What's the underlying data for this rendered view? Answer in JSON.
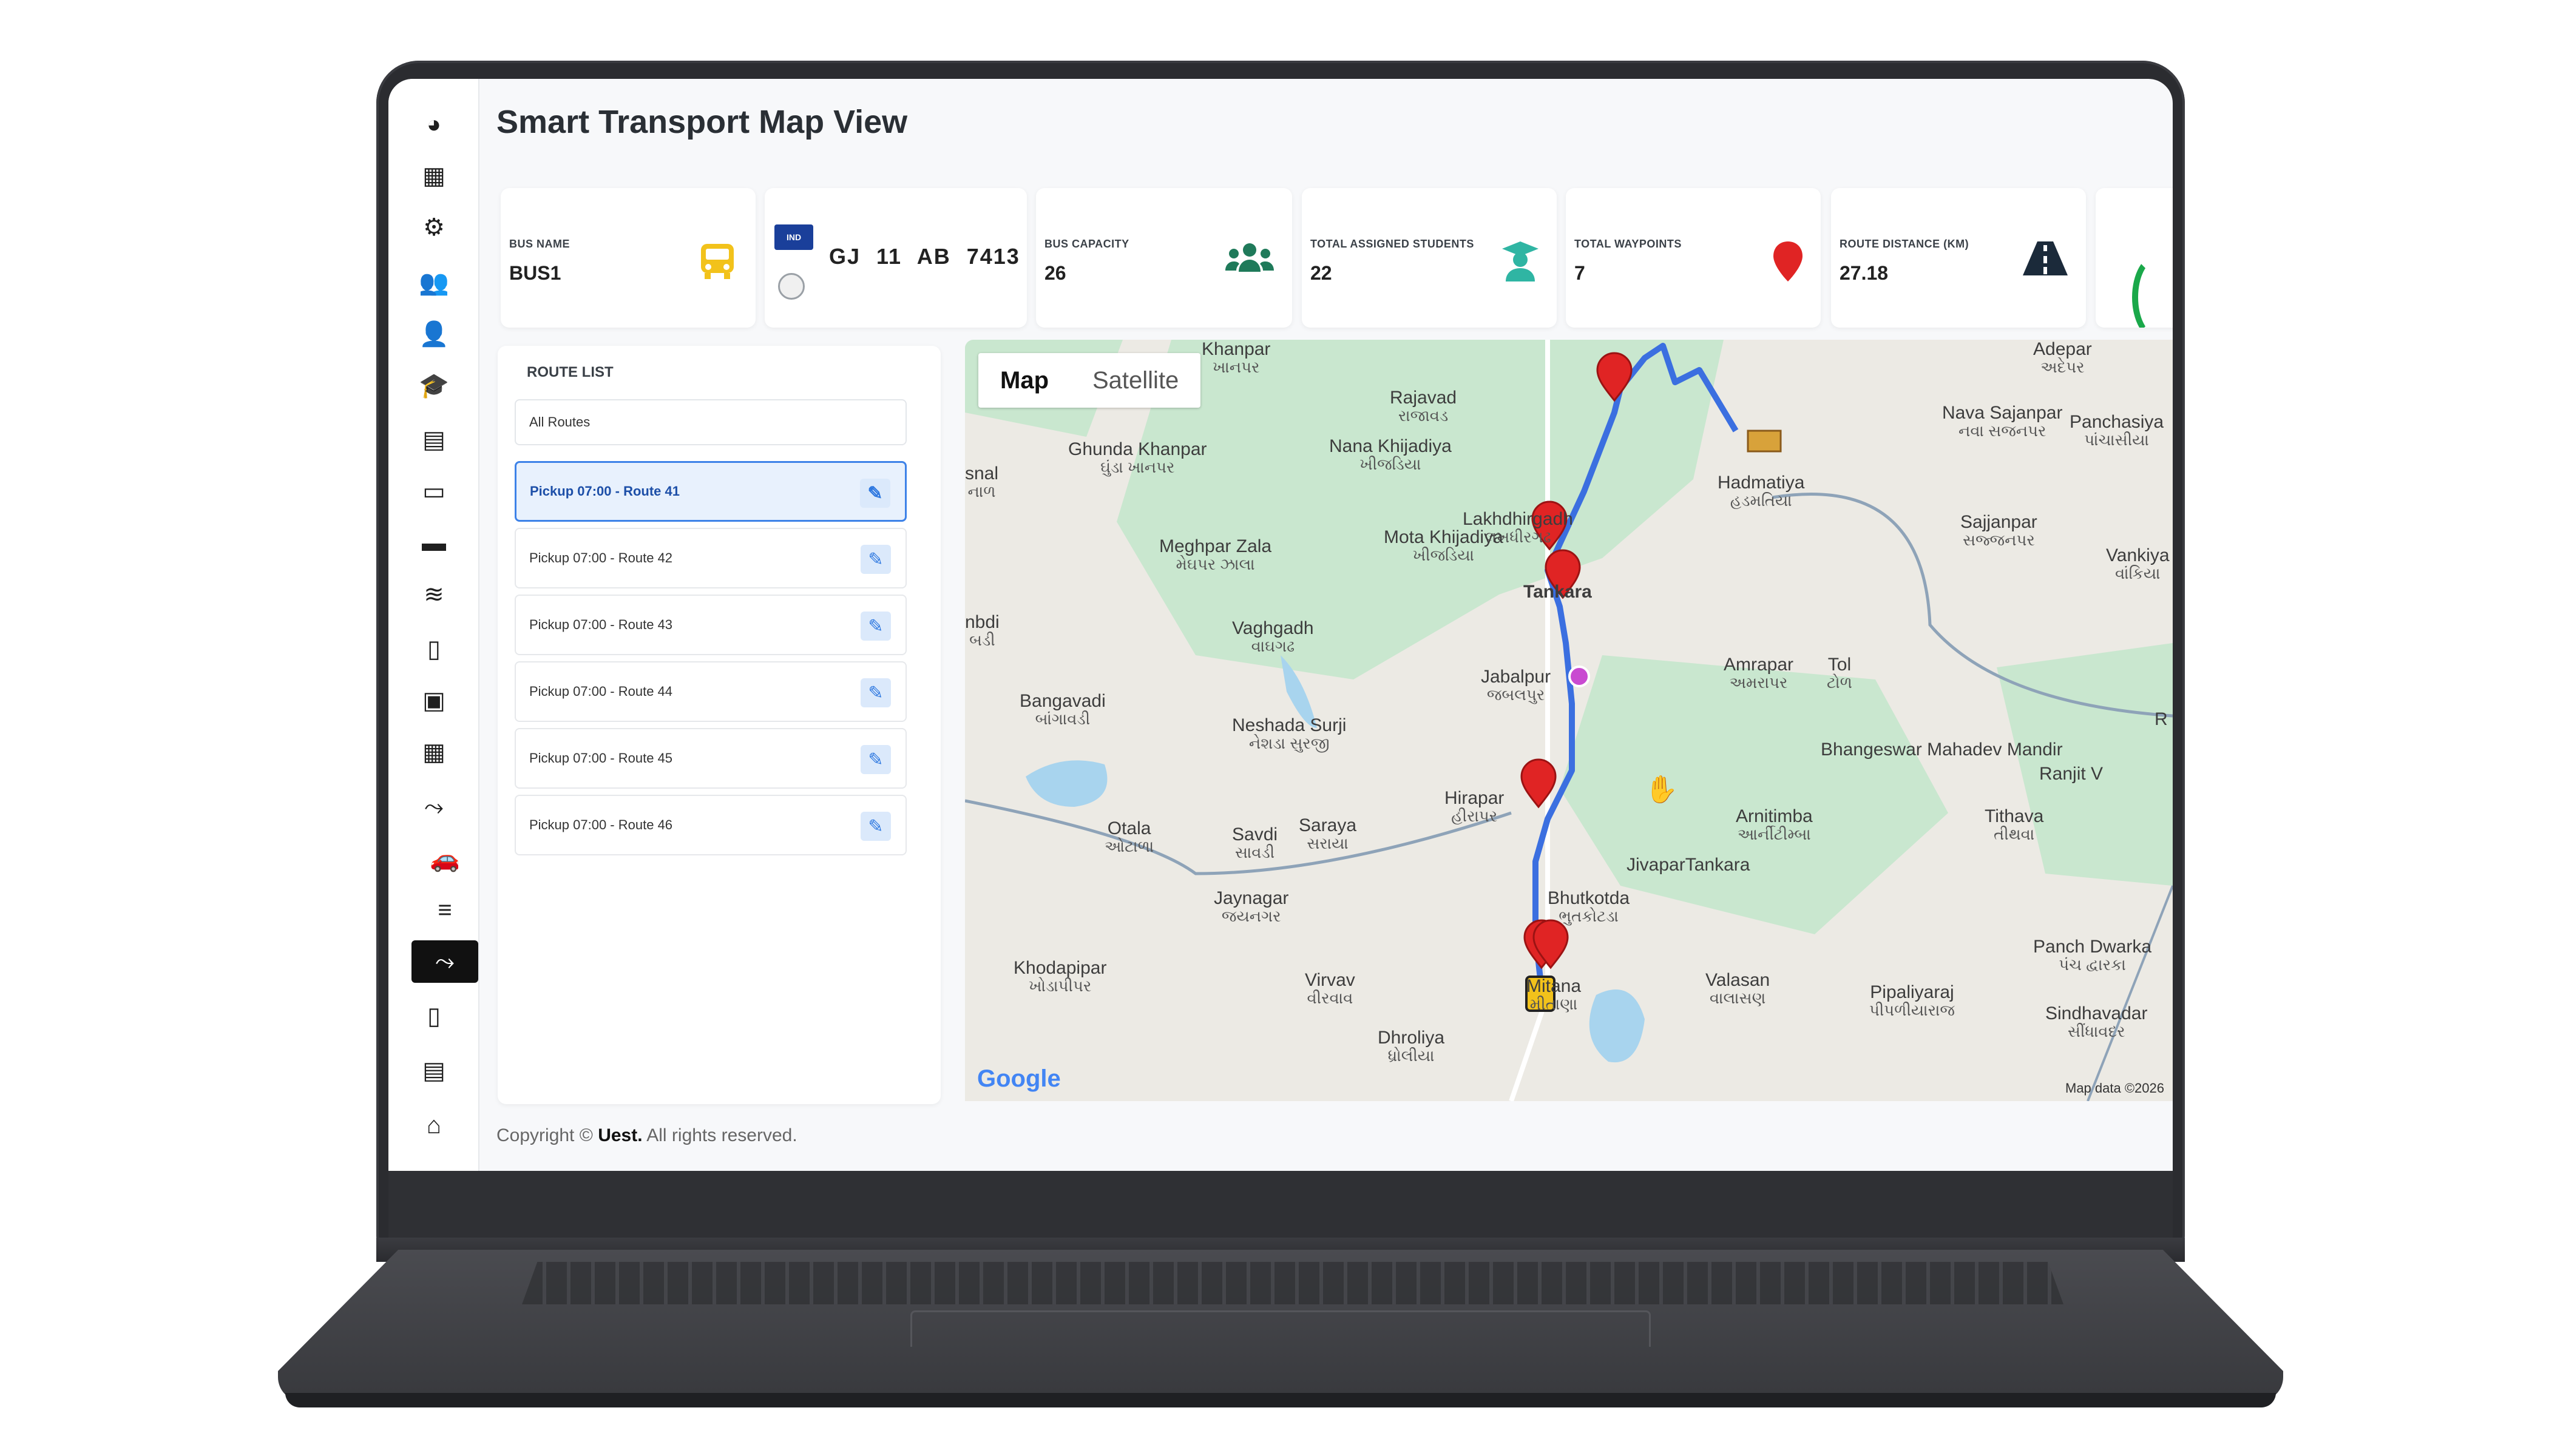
{
  "app": {
    "title": "Smart Transport Map View"
  },
  "sidebar": {
    "items": [
      {
        "icon": "dashboard-icon",
        "glyph": "◕"
      },
      {
        "icon": "calendar-check-icon",
        "glyph": "▦"
      },
      {
        "icon": "gear-icon",
        "glyph": "⚙"
      },
      {
        "icon": "users-icon",
        "glyph": "👥"
      },
      {
        "icon": "user-check-icon",
        "glyph": "👤"
      },
      {
        "icon": "graduate-icon",
        "glyph": "🎓"
      },
      {
        "icon": "calendar-icon",
        "glyph": "▤"
      },
      {
        "icon": "laptop-icon",
        "glyph": "▭"
      },
      {
        "icon": "briefcase-icon",
        "glyph": "▬"
      },
      {
        "icon": "coins-icon",
        "glyph": "≋"
      },
      {
        "icon": "document-icon",
        "glyph": "▯"
      },
      {
        "icon": "images-icon",
        "glyph": "▣"
      },
      {
        "icon": "grid-icon",
        "glyph": "▦"
      },
      {
        "icon": "route-icon",
        "glyph": "⤳"
      },
      {
        "icon": "car-icon",
        "glyph": "🚗"
      },
      {
        "icon": "list-icon",
        "glyph": "≡"
      },
      {
        "icon": "route-active-icon",
        "glyph": "⤳"
      },
      {
        "icon": "file-icon",
        "glyph": "▯"
      },
      {
        "icon": "table-icon",
        "glyph": "▤"
      },
      {
        "icon": "building-icon",
        "glyph": "⌂"
      }
    ]
  },
  "stats": {
    "bus_name_label": "BUS NAME",
    "bus_name_value": "BUS1",
    "plate_badge": "IND",
    "plate_number": "GJ 11 AB 7413",
    "capacity_label": "BUS CAPACITY",
    "capacity_value": "26",
    "students_label": "TOTAL ASSIGNED STUDENTS",
    "students_value": "22",
    "waypoints_label": "TOTAL WAYPOINTS",
    "waypoints_value": "7",
    "distance_label": "ROUTE DISTANCE (KM)",
    "distance_value": "27.18",
    "colors": {
      "bus_icon": "#f2c21b",
      "capacity_icon": "#1f7a5a",
      "students_icon": "#2fb5a3",
      "waypoints_icon": "#e02424",
      "distance_icon": "#1b2a3a"
    }
  },
  "route_list": {
    "title": "ROUTE LIST",
    "filter_value": "All Routes",
    "routes": [
      {
        "label": "Pickup 07:00 - Route 41",
        "active": true
      },
      {
        "label": "Pickup 07:00 - Route 42",
        "active": false
      },
      {
        "label": "Pickup 07:00 - Route 43",
        "active": false
      },
      {
        "label": "Pickup 07:00 - Route 44",
        "active": false
      },
      {
        "label": "Pickup 07:00 - Route 45",
        "active": false
      },
      {
        "label": "Pickup 07:00 - Route 46",
        "active": false
      }
    ]
  },
  "map": {
    "tabs": [
      "Map",
      "Satellite"
    ],
    "selected_tab": "Map",
    "logo": "Google",
    "attribution": "Map data ©2026",
    "places": [
      {
        "name": "Khanpar",
        "sub": "ખાનપર"
      },
      {
        "name": "Rajavad",
        "sub": "રાજાવડ"
      },
      {
        "name": "Ghunda Khanpar",
        "sub": "ઘુંડા ખાનપર"
      },
      {
        "name": "Nana Khijadiya",
        "sub": "ખીજડિયા"
      },
      {
        "name": "Hadmatiya",
        "sub": "હડમતિયા"
      },
      {
        "name": "Nava Sajanpar",
        "sub": "નવા સજનપર"
      },
      {
        "name": "Panchasiya",
        "sub": "પાંચાસીયા"
      },
      {
        "name": "Adepar",
        "sub": "અદેપર"
      },
      {
        "name": "Lakhdhirgadh",
        "sub": "લખધીરગઢ"
      },
      {
        "name": "Meghpar Zala",
        "sub": "મેઘપર ઝાલા"
      },
      {
        "name": "Mota Khijadiya",
        "sub": "ખીજડિયા"
      },
      {
        "name": "Sajjanpar",
        "sub": "સજ્જનપર"
      },
      {
        "name": "Vankiya",
        "sub": "વાંકિયા"
      },
      {
        "name": "Tankara",
        "sub": ""
      },
      {
        "name": "Vaghgadh",
        "sub": "વાઘગઢ"
      },
      {
        "name": "Jabalpur",
        "sub": "જબલપુર"
      },
      {
        "name": "Amrapar",
        "sub": "અમરાપર"
      },
      {
        "name": "Tol",
        "sub": "ટોળ"
      },
      {
        "name": "Bangavadi",
        "sub": "બાંગાવડી"
      },
      {
        "name": "Neshada Surji",
        "sub": "નેશડા સુરજી"
      },
      {
        "name": "Bhangeswar Mahadev Mandir",
        "sub": ""
      },
      {
        "name": "Ranjit V",
        "sub": ""
      },
      {
        "name": "Hirapar",
        "sub": "હીરાપર"
      },
      {
        "name": "Arnitimba",
        "sub": "આર્નીટીમ્બા"
      },
      {
        "name": "Tithava",
        "sub": "તીથવા"
      },
      {
        "name": "Otala",
        "sub": "ઓટાળા"
      },
      {
        "name": "Savdi",
        "sub": "સાવડી"
      },
      {
        "name": "Saraya",
        "sub": "સરાયા"
      },
      {
        "name": "JivaparTankara",
        "sub": ""
      },
      {
        "name": "Jaynagar",
        "sub": "જયનગર"
      },
      {
        "name": "Bhutkotda",
        "sub": "ભુતકોટડા"
      },
      {
        "name": "Panch Dwarka",
        "sub": "પંચ દ્વારકા"
      },
      {
        "name": "Khodapipar",
        "sub": "ખોડાપીપર"
      },
      {
        "name": "Virvav",
        "sub": "વીરવાવ"
      },
      {
        "name": "Mitana",
        "sub": "મીતાણા"
      },
      {
        "name": "Valasan",
        "sub": "વાલાસણ"
      },
      {
        "name": "Pipaliyaraj",
        "sub": "પીપળીયારાજ"
      },
      {
        "name": "Sindhavadar",
        "sub": "સીંધાવદર"
      },
      {
        "name": "Dhroliya",
        "sub": "ધ્રોલીયા"
      },
      {
        "name": "snal",
        "sub": "નાળ"
      },
      {
        "name": "nbdi",
        "sub": "બડી"
      },
      {
        "name": "R",
        "sub": ""
      }
    ],
    "route_color": "#3b6fe0",
    "marker_color": "#e02424",
    "water_color": "#a8d4ee",
    "park_color": "#c9e7cf"
  },
  "footer": {
    "prefix": "Copyright ©",
    "brand": "Uest.",
    "suffix": "All rights reserved."
  }
}
